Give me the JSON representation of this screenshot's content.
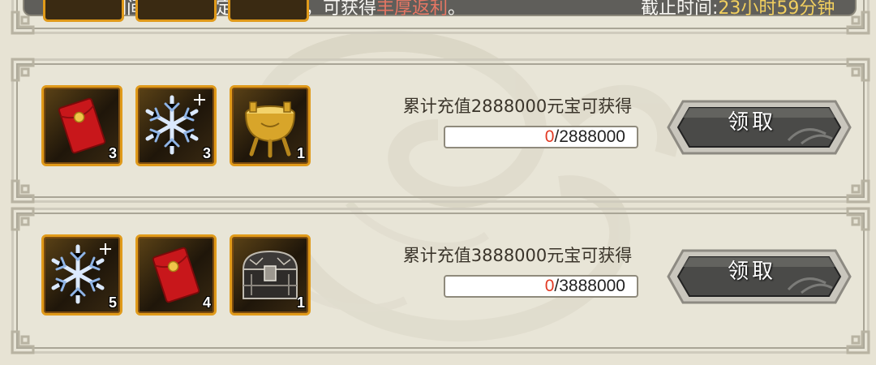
{
  "banner": {
    "notice_prefix": "活动期间，充值指定数量元宝，可获得",
    "notice_highlight": "丰厚返利",
    "notice_suffix": "。",
    "countdown_prefix": "截止时间:",
    "countdown_value": "23小时59分钟"
  },
  "rewards": [
    {
      "requirement": "累计充值2888000元宝可获得",
      "current": "0",
      "separator": "/",
      "target": "2888000",
      "claim_label": "领取",
      "items": [
        {
          "icon": "red-envelope-icon",
          "qty": "3"
        },
        {
          "icon": "snowflake-icon",
          "qty": "3"
        },
        {
          "icon": "golden-cauldron-icon",
          "qty": "1"
        }
      ]
    },
    {
      "requirement": "累计充值3888000元宝可获得",
      "current": "0",
      "separator": "/",
      "target": "3888000",
      "claim_label": "领取",
      "items": [
        {
          "icon": "snowflake-icon",
          "qty": "5"
        },
        {
          "icon": "red-envelope-icon",
          "qty": "4"
        },
        {
          "icon": "treasure-chest-icon",
          "qty": "1"
        }
      ]
    }
  ],
  "colors": {
    "background": "#e7e3d4",
    "item_border": "#e09a1a",
    "progress_current": "#e23a24",
    "highlight_red": "#e23a24",
    "highlight_yellow": "#f4c21c"
  }
}
